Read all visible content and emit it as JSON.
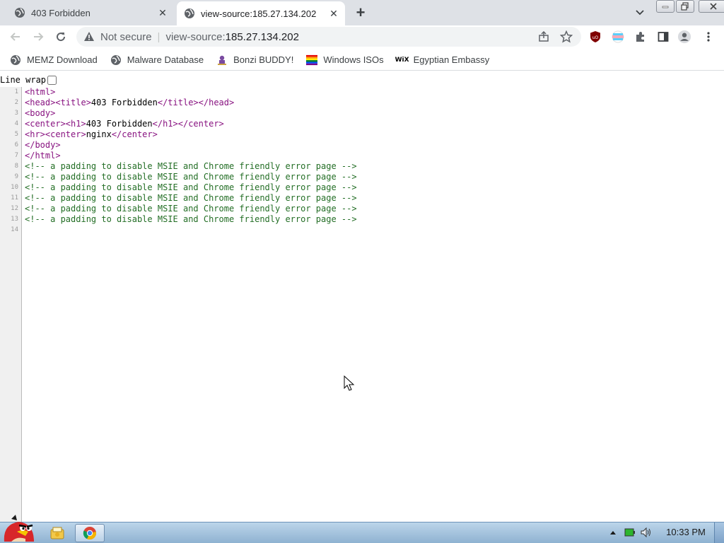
{
  "tabs": [
    {
      "title": "403 Forbidden",
      "active": false
    },
    {
      "title": "view-source:185.27.134.202",
      "active": true
    }
  ],
  "omnibox": {
    "security_label": "Not secure",
    "url_prefix": "view-source:",
    "url_host": "185.27.134.202"
  },
  "bookmarks": [
    {
      "label": "MEMZ Download",
      "icon": "globe-icon"
    },
    {
      "label": "Malware Database",
      "icon": "globe-icon"
    },
    {
      "label": "Bonzi BUDDY!",
      "icon": "bonzi-icon"
    },
    {
      "label": "Windows ISOs",
      "icon": "rainbow-flag-icon"
    },
    {
      "label": "Egyptian Embassy",
      "icon": "wix-icon"
    }
  ],
  "source": {
    "line_wrap_label": "Line wrap",
    "lines": [
      {
        "n": "1",
        "parts": [
          {
            "c": "tag",
            "t": "<html>"
          }
        ]
      },
      {
        "n": "2",
        "parts": [
          {
            "c": "tag",
            "t": "<head><title>"
          },
          {
            "c": "txt",
            "t": "403 Forbidden"
          },
          {
            "c": "tag",
            "t": "</title></head>"
          }
        ]
      },
      {
        "n": "3",
        "parts": [
          {
            "c": "tag",
            "t": "<body>"
          }
        ]
      },
      {
        "n": "4",
        "parts": [
          {
            "c": "tag",
            "t": "<center><h1>"
          },
          {
            "c": "txt",
            "t": "403 Forbidden"
          },
          {
            "c": "tag",
            "t": "</h1></center>"
          }
        ]
      },
      {
        "n": "5",
        "parts": [
          {
            "c": "tag",
            "t": "<hr><center>"
          },
          {
            "c": "txt",
            "t": "nginx"
          },
          {
            "c": "tag",
            "t": "</center>"
          }
        ]
      },
      {
        "n": "6",
        "parts": [
          {
            "c": "tag",
            "t": "</body>"
          }
        ]
      },
      {
        "n": "7",
        "parts": [
          {
            "c": "tag",
            "t": "</html>"
          }
        ]
      },
      {
        "n": "8",
        "parts": [
          {
            "c": "cmt",
            "t": "<!-- a padding to disable MSIE and Chrome friendly error page -->"
          }
        ]
      },
      {
        "n": "9",
        "parts": [
          {
            "c": "cmt",
            "t": "<!-- a padding to disable MSIE and Chrome friendly error page -->"
          }
        ]
      },
      {
        "n": "10",
        "parts": [
          {
            "c": "cmt",
            "t": "<!-- a padding to disable MSIE and Chrome friendly error page -->"
          }
        ]
      },
      {
        "n": "11",
        "parts": [
          {
            "c": "cmt",
            "t": "<!-- a padding to disable MSIE and Chrome friendly error page -->"
          }
        ]
      },
      {
        "n": "12",
        "parts": [
          {
            "c": "cmt",
            "t": "<!-- a padding to disable MSIE and Chrome friendly error page -->"
          }
        ]
      },
      {
        "n": "13",
        "parts": [
          {
            "c": "cmt",
            "t": "<!-- a padding to disable MSIE and Chrome friendly error page -->"
          }
        ]
      },
      {
        "n": "14",
        "parts": []
      }
    ]
  },
  "taskbar": {
    "clock": "10:33 PM"
  },
  "colors": {
    "tag": "#881280",
    "comment": "#236e25",
    "tabstrip": "#dee1e6",
    "omnibox": "#f1f3f4"
  }
}
